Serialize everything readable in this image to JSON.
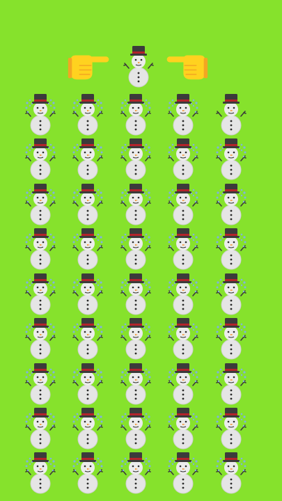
{
  "puzzle": {
    "prompt_icons": [
      "hand-pointing-right-icon",
      "snowman-icon",
      "hand-pointing-left-icon"
    ],
    "target": "snowman-without-snow",
    "grid": {
      "rows": 9,
      "cols": 5,
      "cell_icon": "snowman-with-snow-icon",
      "odd_one_out": {
        "row": 0,
        "col": 4
      }
    }
  },
  "colors": {
    "background": "#86e22c",
    "hand": "#ffd21f",
    "hand_shadow": "#f3a622",
    "snow_body": "#e5e5e5",
    "snow_shade": "#c9c9c9",
    "hat": "#3b3b3b",
    "hat_band": "#b3232b",
    "nose": "#f5891f",
    "flake": "#7fb3dd"
  }
}
